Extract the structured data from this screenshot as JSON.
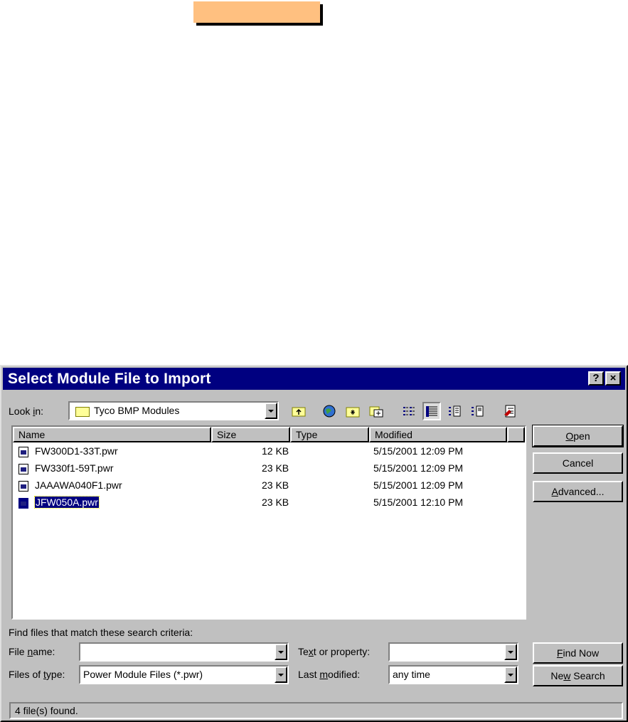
{
  "dialog": {
    "title": "Select Module File to Import",
    "help_label": "?",
    "close_label": "×"
  },
  "look_in": {
    "label_pre": "Look ",
    "label_u": "i",
    "label_post": "n:",
    "value": "Tyco BMP Modules"
  },
  "columns": {
    "name": "Name",
    "size": "Size",
    "type": "Type",
    "modified": "Modified"
  },
  "files": [
    {
      "name": "FW300D1-33T.pwr",
      "size": "12 KB",
      "type": "",
      "modified": "5/15/2001 12:09 PM"
    },
    {
      "name": "FW330f1-59T.pwr",
      "size": "23 KB",
      "type": "",
      "modified": "5/15/2001 12:09 PM"
    },
    {
      "name": "JAAAWA040F1.pwr",
      "size": "23 KB",
      "type": "",
      "modified": "5/15/2001 12:09 PM"
    },
    {
      "name": "JFW050A.pwr",
      "size": "23 KB",
      "type": "",
      "modified": "5/15/2001 12:10 PM"
    }
  ],
  "buttons": {
    "open_u": "O",
    "open_rest": "pen",
    "cancel": "Cancel",
    "advanced_u": "A",
    "advanced_rest": "dvanced...",
    "find_now_u": "F",
    "find_now_rest": "ind Now",
    "new_search_pre": "Ne",
    "new_search_u": "w",
    "new_search_post": " Search"
  },
  "search": {
    "criteria_label": "Find files that match these search criteria:",
    "file_name_pre": "File ",
    "file_name_u": "n",
    "file_name_post": "ame:",
    "file_name_value": "",
    "text_prop_pre": "Te",
    "text_prop_u": "x",
    "text_prop_post": "t or property:",
    "text_prop_value": "",
    "files_of_type_pre": "Files of ",
    "files_of_type_u": "t",
    "files_of_type_post": "ype:",
    "files_of_type_value": "Power Module Files (*.pwr)",
    "last_modified_pre": "Last ",
    "last_modified_u": "m",
    "last_modified_post": "odified:",
    "last_modified_value": "any time"
  },
  "status": "4 file(s) found.",
  "icons": [
    "folder-icon",
    "up-folder-icon",
    "search-web-icon",
    "create-folder-icon",
    "add-favorites-icon",
    "list-view-icon",
    "details-view-icon",
    "properties-view-icon",
    "preview-view-icon",
    "commands-icon",
    "file-icon"
  ],
  "colors": {
    "titlebar": "#000080",
    "face": "#c0c0c0",
    "top_bar": "#ffc080",
    "selection": "#000080"
  }
}
